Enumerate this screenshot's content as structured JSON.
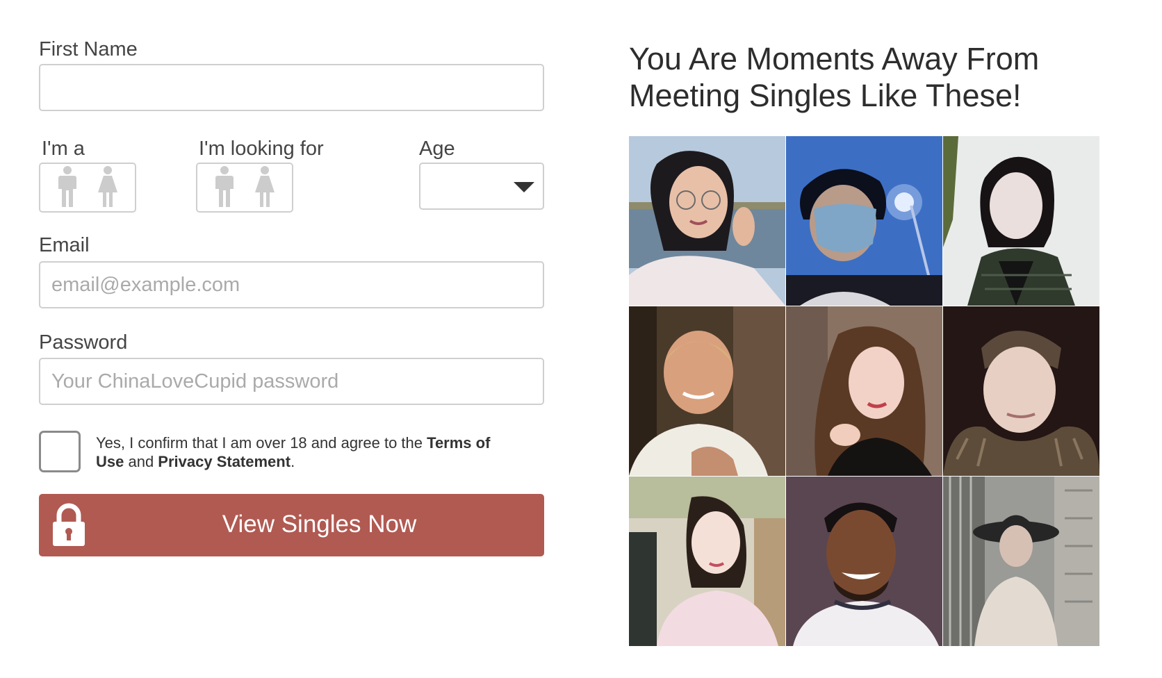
{
  "form": {
    "first_name": {
      "label": "First Name",
      "value": "",
      "placeholder": ""
    },
    "gender": {
      "label": "I'm a",
      "options": [
        "male-icon",
        "female-icon"
      ]
    },
    "seeking": {
      "label": "I'm looking for",
      "options": [
        "male-icon",
        "female-icon"
      ]
    },
    "age": {
      "label": "Age",
      "value": ""
    },
    "email": {
      "label": "Email",
      "value": "",
      "placeholder": "email@example.com"
    },
    "password": {
      "label": "Password",
      "value": "",
      "placeholder": "Your ChinaLoveCupid password"
    },
    "consent": {
      "prefix": "Yes, I confirm that I am over 18 and agree to the ",
      "terms_link": "Terms of Use",
      "middle": " and ",
      "privacy_link": "Privacy Statement",
      "suffix": "."
    },
    "submit_label": "View Singles Now"
  },
  "promo": {
    "title": "You Are Moments Away From Meeting Singles Like These!",
    "profiles": [
      {
        "name": "profile-photo-1"
      },
      {
        "name": "profile-photo-2"
      },
      {
        "name": "profile-photo-3"
      },
      {
        "name": "profile-photo-4"
      },
      {
        "name": "profile-photo-5"
      },
      {
        "name": "profile-photo-6"
      },
      {
        "name": "profile-photo-7"
      },
      {
        "name": "profile-photo-8"
      },
      {
        "name": "profile-photo-9"
      }
    ]
  },
  "colors": {
    "button": "#b05a52",
    "border": "#cfcfcf",
    "icon_gray": "#cccccc",
    "text": "#333333"
  }
}
